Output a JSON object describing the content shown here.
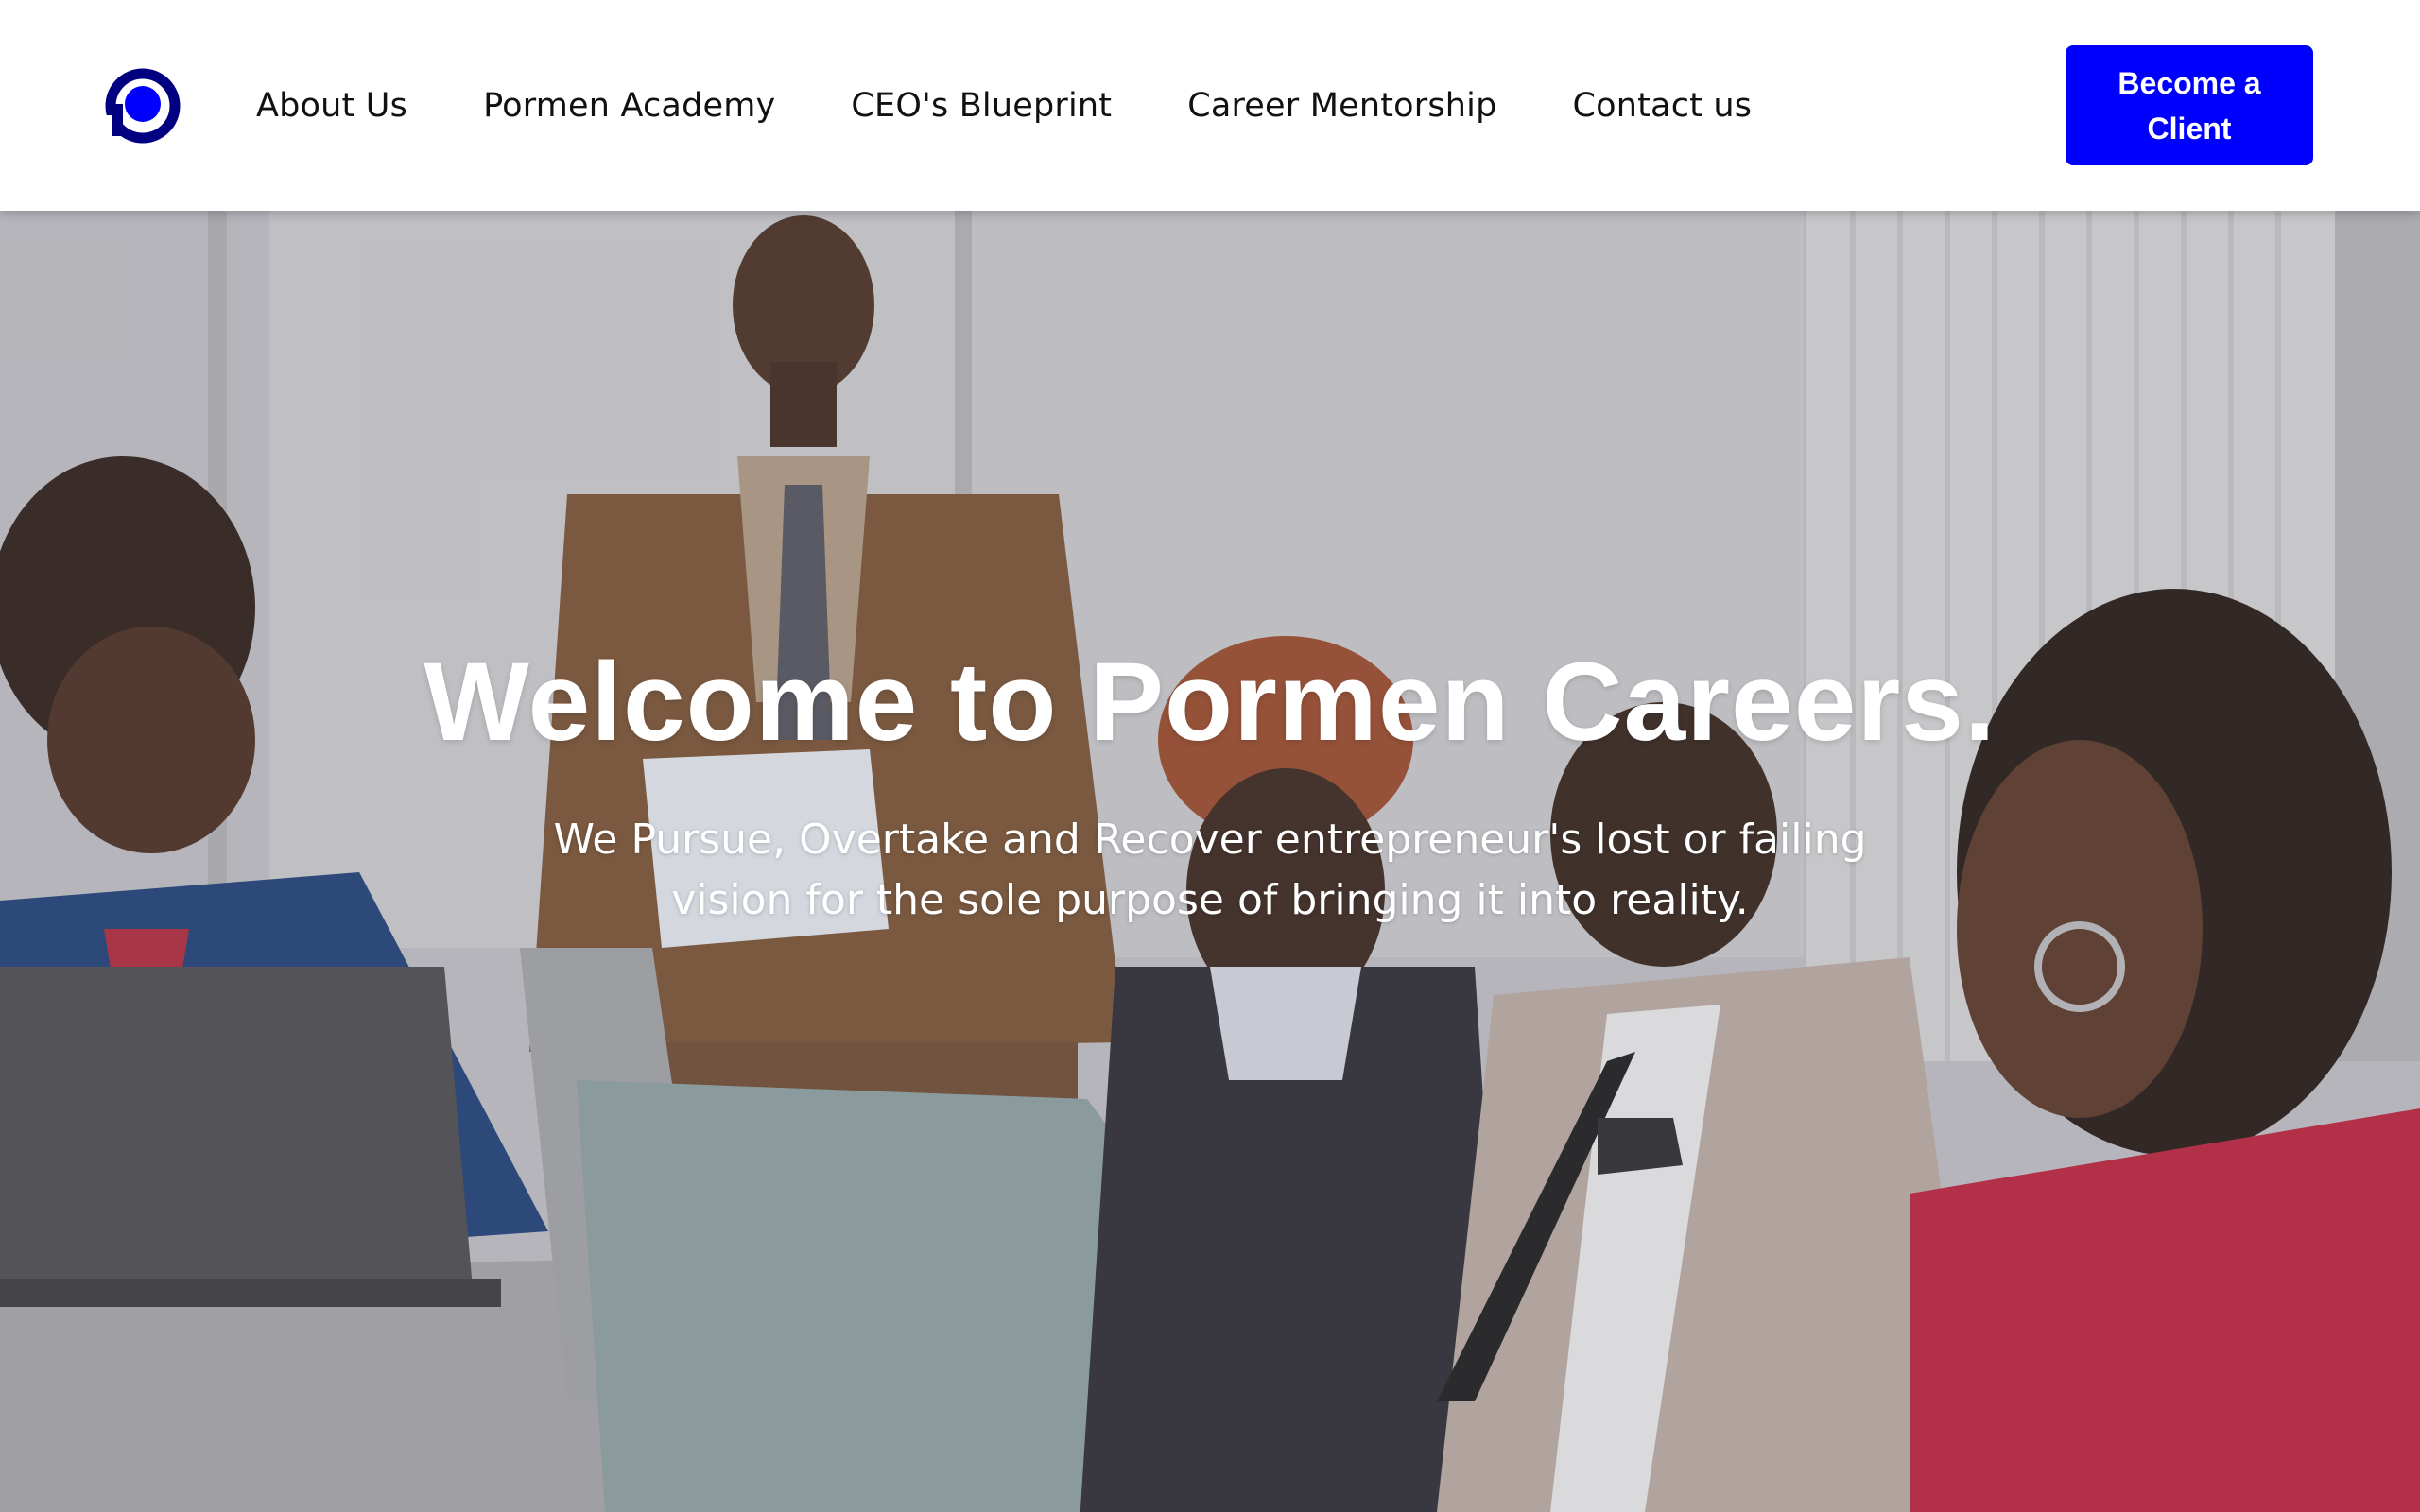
{
  "brand": {
    "logo_icon": "pormen-p-logo",
    "accent_color": "#0000ff",
    "logo_dark_color": "#000080"
  },
  "nav": {
    "items": [
      {
        "label": "About Us"
      },
      {
        "label": "Pormen Academy"
      },
      {
        "label": "CEO's Blueprint"
      },
      {
        "label": "Career Mentorship"
      },
      {
        "label": "Contact us"
      }
    ]
  },
  "cta": {
    "label": "Become a Client"
  },
  "hero": {
    "title": "Welcome to Pormen Careers.",
    "subtitle": "We Pursue, Overtake and Recover entrepreneur's lost or failing vision for the sole purpose of bringing it into reality.",
    "image": "office-meeting-photo"
  }
}
